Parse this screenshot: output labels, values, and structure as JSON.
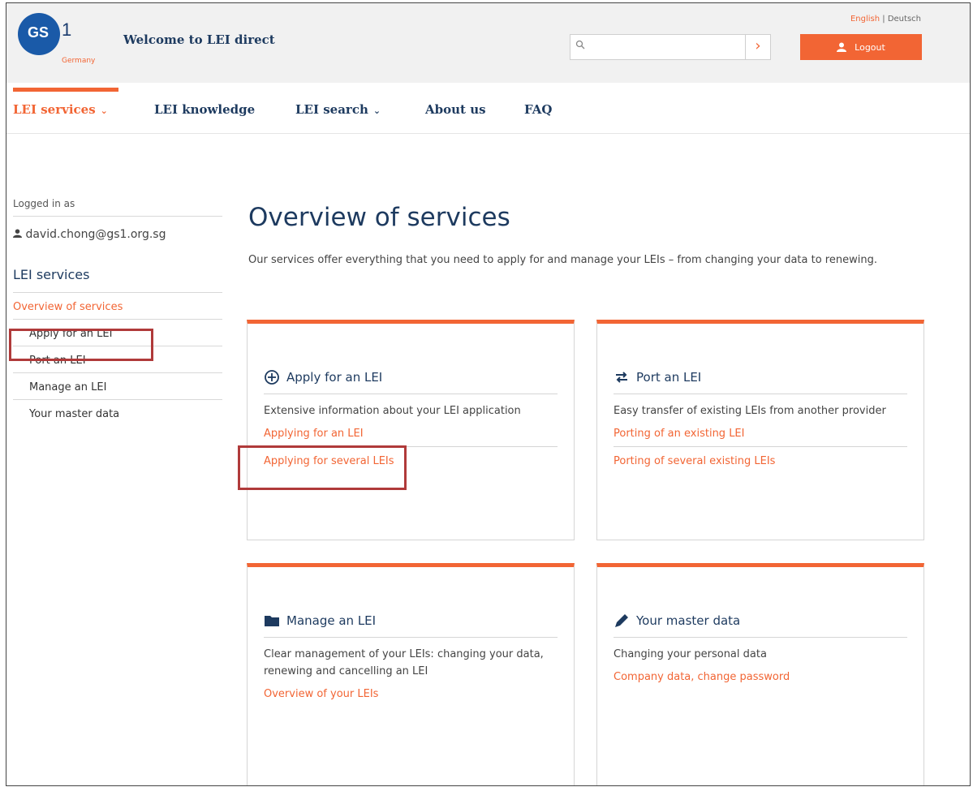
{
  "header": {
    "logo_text": "GS",
    "logo_one": "1",
    "logo_country": "Germany",
    "welcome": "Welcome to LEI direct",
    "lang_english": "English",
    "lang_sep": " | ",
    "lang_deutsch": "Deutsch",
    "search_placeholder": "",
    "search_go": "›",
    "logout_label": "Logout"
  },
  "nav": {
    "items": [
      {
        "label": "LEI services",
        "chevron": "⌄"
      },
      {
        "label": "LEI knowledge"
      },
      {
        "label": "LEI search",
        "chevron": "⌄"
      },
      {
        "label": "About us"
      },
      {
        "label": "FAQ"
      }
    ]
  },
  "sidebar": {
    "logged_in_label": "Logged in as",
    "user": "david.chong@gs1.org.sg",
    "section_title": "LEI services",
    "items": [
      {
        "label": "Overview of services"
      },
      {
        "label": "Apply for an LEI"
      },
      {
        "label": "Port an LEI"
      },
      {
        "label": "Manage an LEI"
      },
      {
        "label": "Your master data"
      }
    ]
  },
  "main": {
    "title": "Overview of services",
    "description": "Our services offer everything that you need to apply for and manage your LEIs – from changing your data to renewing.",
    "cards": [
      {
        "title": "Apply for an LEI",
        "icon": "plus-circle-icon",
        "description": "Extensive information about your LEI application",
        "links": [
          "Applying for an LEI",
          "Applying for several LEIs"
        ]
      },
      {
        "title": "Port an LEI",
        "icon": "transfer-icon",
        "description": "Easy transfer of existing LEIs from another provider",
        "links": [
          "Porting of an existing LEI",
          "Porting of several existing LEIs"
        ]
      },
      {
        "title": "Manage an LEI",
        "icon": "folder-icon",
        "description": "Clear management of your LEIs: changing your data, renewing and cancelling an LEI",
        "links": [
          "Overview of your LEIs"
        ]
      },
      {
        "title": "Your master data",
        "icon": "pencil-icon",
        "description": "Changing your personal data",
        "links": [
          "Company data, change password"
        ]
      }
    ]
  },
  "colors": {
    "accent": "#f26534",
    "navy": "#1d3a5f",
    "highlight": "#b03a3a"
  }
}
